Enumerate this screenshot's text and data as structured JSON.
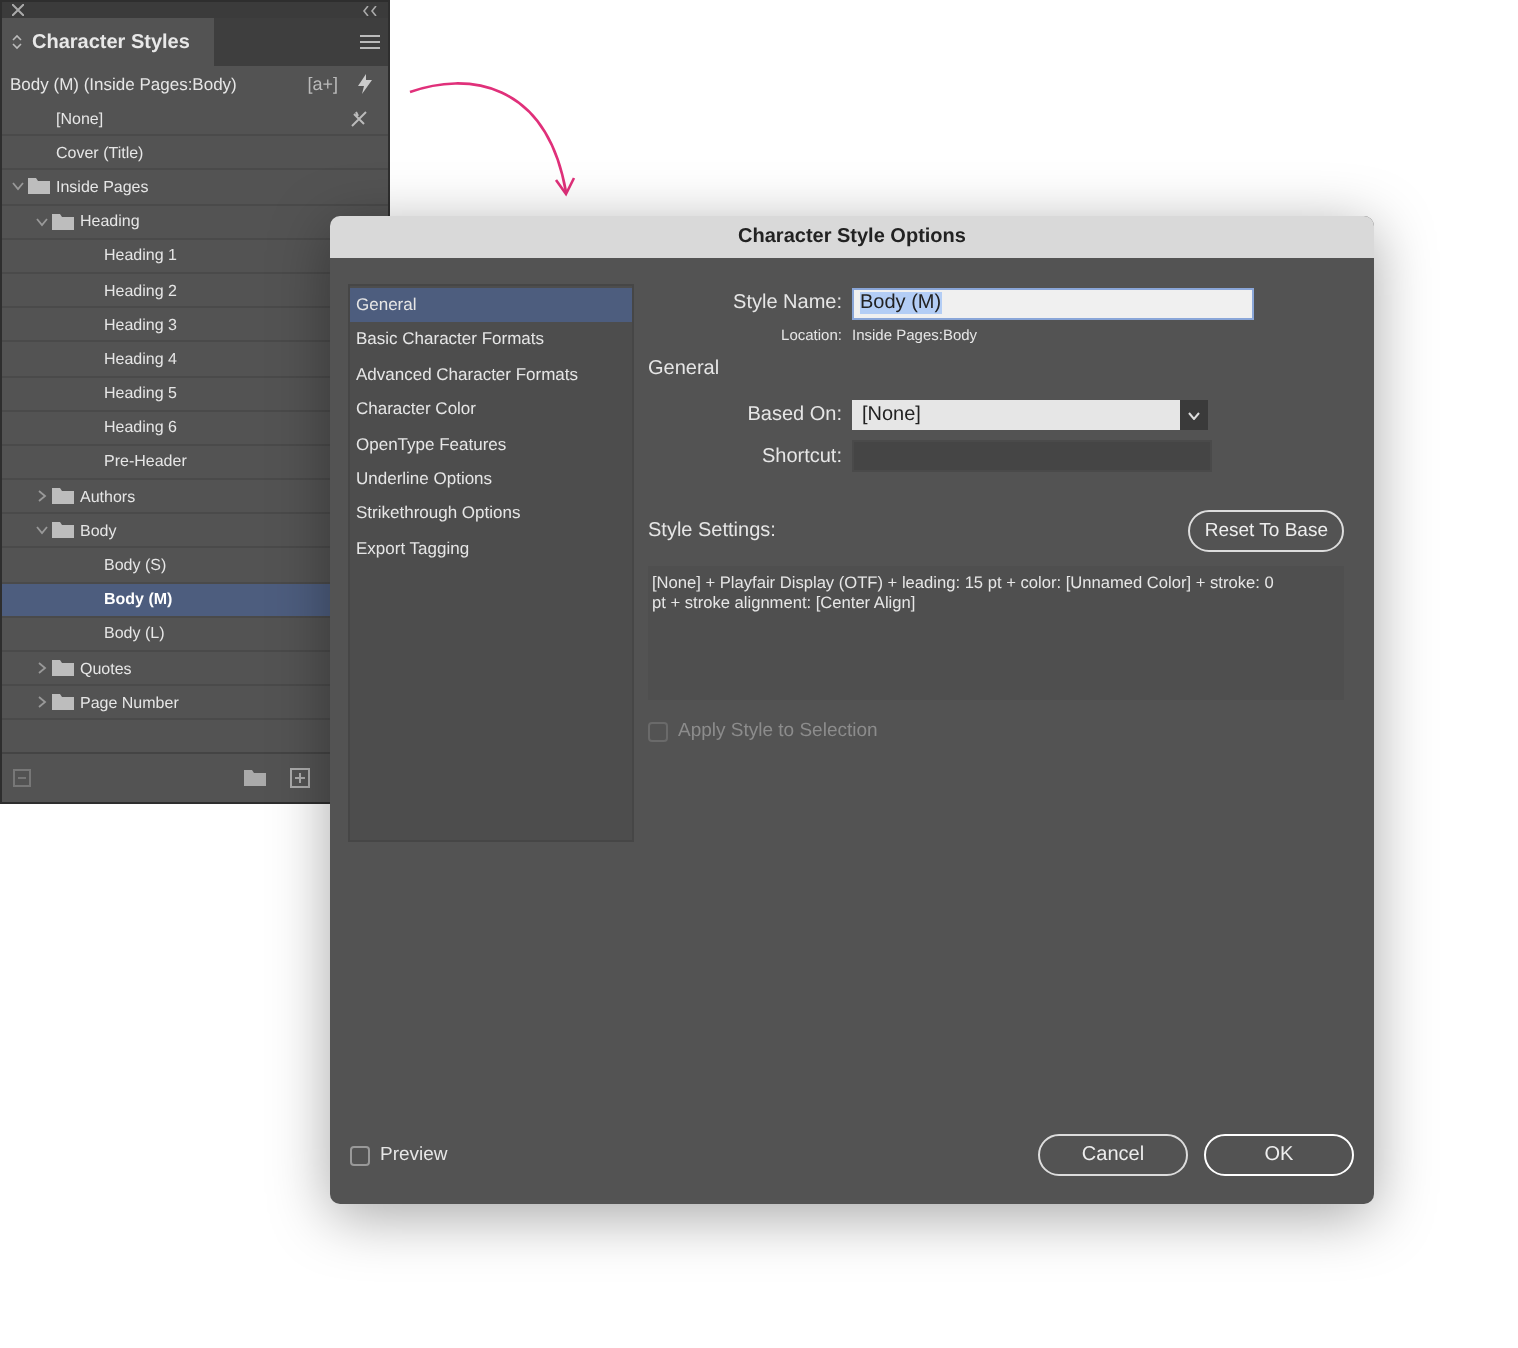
{
  "panel": {
    "title": "Character Styles",
    "current_style": "Body (M) (Inside Pages:Body)",
    "new_style_glyph": "[a+]",
    "tree": [
      {
        "kind": "style",
        "label": "[None]",
        "selected": false
      },
      {
        "kind": "style",
        "label": "Cover (Title)",
        "selected": false
      },
      {
        "kind": "folder",
        "label": "Inside Pages",
        "expanded": true,
        "children": [
          {
            "kind": "folder",
            "label": "Heading",
            "expanded": true,
            "children": [
              {
                "kind": "style",
                "label": "Heading 1",
                "selected": false
              },
              {
                "kind": "style",
                "label": "Heading 2",
                "selected": false
              },
              {
                "kind": "style",
                "label": "Heading 3",
                "selected": false
              },
              {
                "kind": "style",
                "label": "Heading 4",
                "selected": false
              },
              {
                "kind": "style",
                "label": "Heading 5",
                "selected": false
              },
              {
                "kind": "style",
                "label": "Heading 6",
                "selected": false
              },
              {
                "kind": "style",
                "label": "Pre-Header",
                "selected": false
              }
            ]
          },
          {
            "kind": "folder",
            "label": "Authors",
            "expanded": false
          },
          {
            "kind": "folder",
            "label": "Body",
            "expanded": true,
            "children": [
              {
                "kind": "style",
                "label": "Body (S)",
                "selected": false
              },
              {
                "kind": "style",
                "label": "Body (M)",
                "selected": true
              },
              {
                "kind": "style",
                "label": "Body (L)",
                "selected": false
              }
            ]
          },
          {
            "kind": "folder",
            "label": "Quotes",
            "expanded": false
          },
          {
            "kind": "folder",
            "label": "Page Number",
            "expanded": false
          }
        ]
      }
    ]
  },
  "dialog": {
    "title": "Character Style Options",
    "categories": [
      {
        "label": "General",
        "selected": true
      },
      {
        "label": "Basic Character Formats",
        "selected": false
      },
      {
        "label": "Advanced Character Formats",
        "selected": false
      },
      {
        "label": "Character Color",
        "selected": false
      },
      {
        "label": "OpenType Features",
        "selected": false
      },
      {
        "label": "Underline Options",
        "selected": false
      },
      {
        "label": "Strikethrough Options",
        "selected": false
      },
      {
        "label": "Export Tagging",
        "selected": false
      }
    ],
    "style_name": {
      "label": "Style Name:",
      "value": "Body (M)"
    },
    "location": {
      "label": "Location:",
      "value": "Inside Pages:Body"
    },
    "section_heading": "General",
    "based_on": {
      "label": "Based On:",
      "value": "[None]"
    },
    "shortcut": {
      "label": "Shortcut:"
    },
    "style_settings": {
      "label": "Style Settings:",
      "text": "[None] + Playfair Display (OTF) + leading: 15 pt + color: [Unnamed Color] + stroke: 0 pt + stroke alignment: [Center Align]"
    },
    "reset_button": "Reset To Base",
    "apply_style": {
      "label": "Apply Style to Selection",
      "checked": false,
      "disabled": true
    },
    "preview": {
      "label": "Preview",
      "checked": false
    },
    "buttons": [
      {
        "label": "Cancel",
        "kind": "secondary"
      },
      {
        "label": "OK",
        "kind": "primary"
      }
    ]
  }
}
